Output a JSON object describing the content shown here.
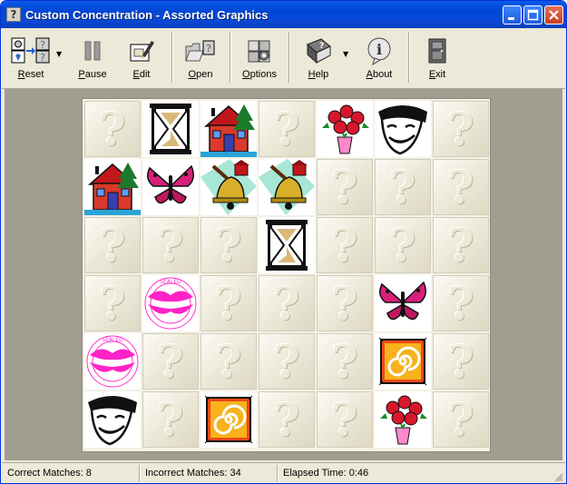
{
  "window": {
    "title": "Custom Concentration - Assorted Graphics",
    "icon": "app-question-icon"
  },
  "toolbar": {
    "items": [
      {
        "label": "Reset",
        "accel": "R",
        "rest": "eset",
        "icon": "reset-icon",
        "dropdown": true
      },
      {
        "label": "Pause",
        "accel": "P",
        "rest": "ause",
        "icon": "pause-icon"
      },
      {
        "label": "Edit",
        "accel": "E",
        "rest": "dit",
        "icon": "edit-icon"
      },
      {
        "label": "Open",
        "accel": "O",
        "rest": "pen",
        "icon": "open-folder-icon"
      },
      {
        "label": "Options",
        "accel": "O",
        "rest": "ptions",
        "icon": "options-icon"
      },
      {
        "label": "Help",
        "accel": "H",
        "rest": "elp",
        "icon": "help-book-icon",
        "dropdown": true
      },
      {
        "label": "About",
        "accel": "A",
        "rest": "bout",
        "icon": "about-info-icon"
      },
      {
        "label": "Exit",
        "accel": "E",
        "rest": "xit",
        "icon": "exit-door-icon"
      }
    ]
  },
  "board": {
    "rows": 6,
    "cols": 7,
    "cards": [
      [
        "hidden",
        "hourglass",
        "house",
        "hidden",
        "roses",
        "mask",
        "hidden"
      ],
      [
        "house",
        "butterfly",
        "bell",
        "bell",
        "hidden",
        "hidden",
        "hidden"
      ],
      [
        "hidden",
        "hidden",
        "hidden",
        "hourglass",
        "hidden",
        "hidden",
        "hidden"
      ],
      [
        "hidden",
        "lips",
        "hidden",
        "hidden",
        "hidden",
        "butterfly",
        "hidden"
      ],
      [
        "lips",
        "hidden",
        "hidden",
        "hidden",
        "hidden",
        "spiral",
        "hidden"
      ],
      [
        "mask",
        "hidden",
        "spiral",
        "hidden",
        "hidden",
        "roses",
        "hidden"
      ]
    ],
    "hidden_glyph": "?"
  },
  "status": {
    "correct": "Correct Matches: 8",
    "incorrect": "Incorrect Matches: 34",
    "elapsed": "Elapsed Time: 0:46"
  },
  "colors": {
    "titlebar": "#0054e3",
    "window_bg": "#ece9d8",
    "board_bg": "#a19d91",
    "accent_pink": "#ff33cc"
  }
}
